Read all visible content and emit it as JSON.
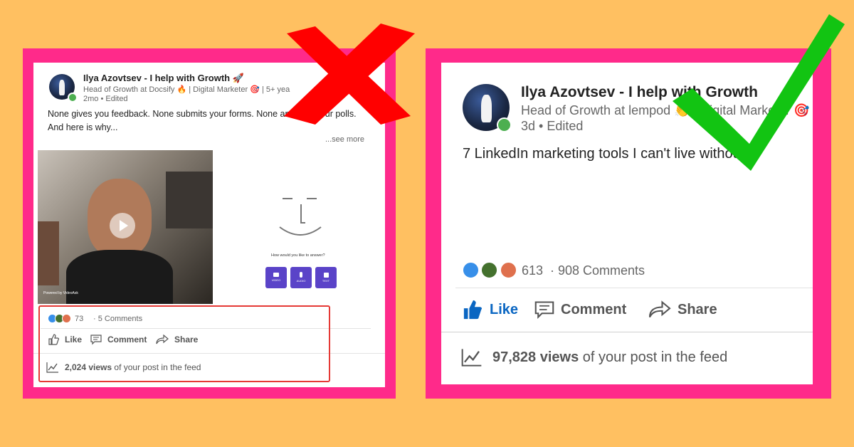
{
  "left_post": {
    "author": "Ilya Azovtsev - I help with Growth 🚀",
    "headline": "Head of Growth at Docsify 🔥 | Digital Marketer 🎯 | 5+ yea",
    "meta": "2mo • Edited",
    "body_line1": "None gives you feedback. None submits your forms. None answers your polls.",
    "body_line2": "And here is why...",
    "see_more": "...see more",
    "video_powered": "Powered by VideoAsk",
    "answer_prompt": "How would you like to answer?",
    "answer_options": [
      "VIDEO",
      "AUDIO",
      "TEXT"
    ],
    "reactions_count": "73",
    "comments": "· 5 Comments",
    "actions": {
      "like": "Like",
      "comment": "Comment",
      "share": "Share"
    },
    "views_number": "2,024 views",
    "views_suffix": " of your post in the feed"
  },
  "right_post": {
    "author": "Ilya Azovtsev - I help with Growth",
    "headline": "Head of Growth at lempod 👏 | Digital Marketer 🎯",
    "meta": "3d • Edited",
    "body": "7 LinkedIn marketing tools I can't live without👇",
    "reactions_count": "613",
    "comments": "· 908 Comments",
    "actions": {
      "like": "Like",
      "comment": "Comment",
      "share": "Share"
    },
    "views_number": "97,828 views",
    "views_suffix": " of your post in the feed"
  },
  "colors": {
    "background": "#ffc061",
    "frame": "#ff2a8a",
    "cross": "#ff0000",
    "check": "#12c412",
    "like_blue": "#0a66c2",
    "highlight_box": "#e53935"
  },
  "icons": [
    "cross-mark",
    "check-mark",
    "like-icon",
    "comment-icon",
    "share-icon",
    "analytics-icon",
    "play-icon"
  ]
}
